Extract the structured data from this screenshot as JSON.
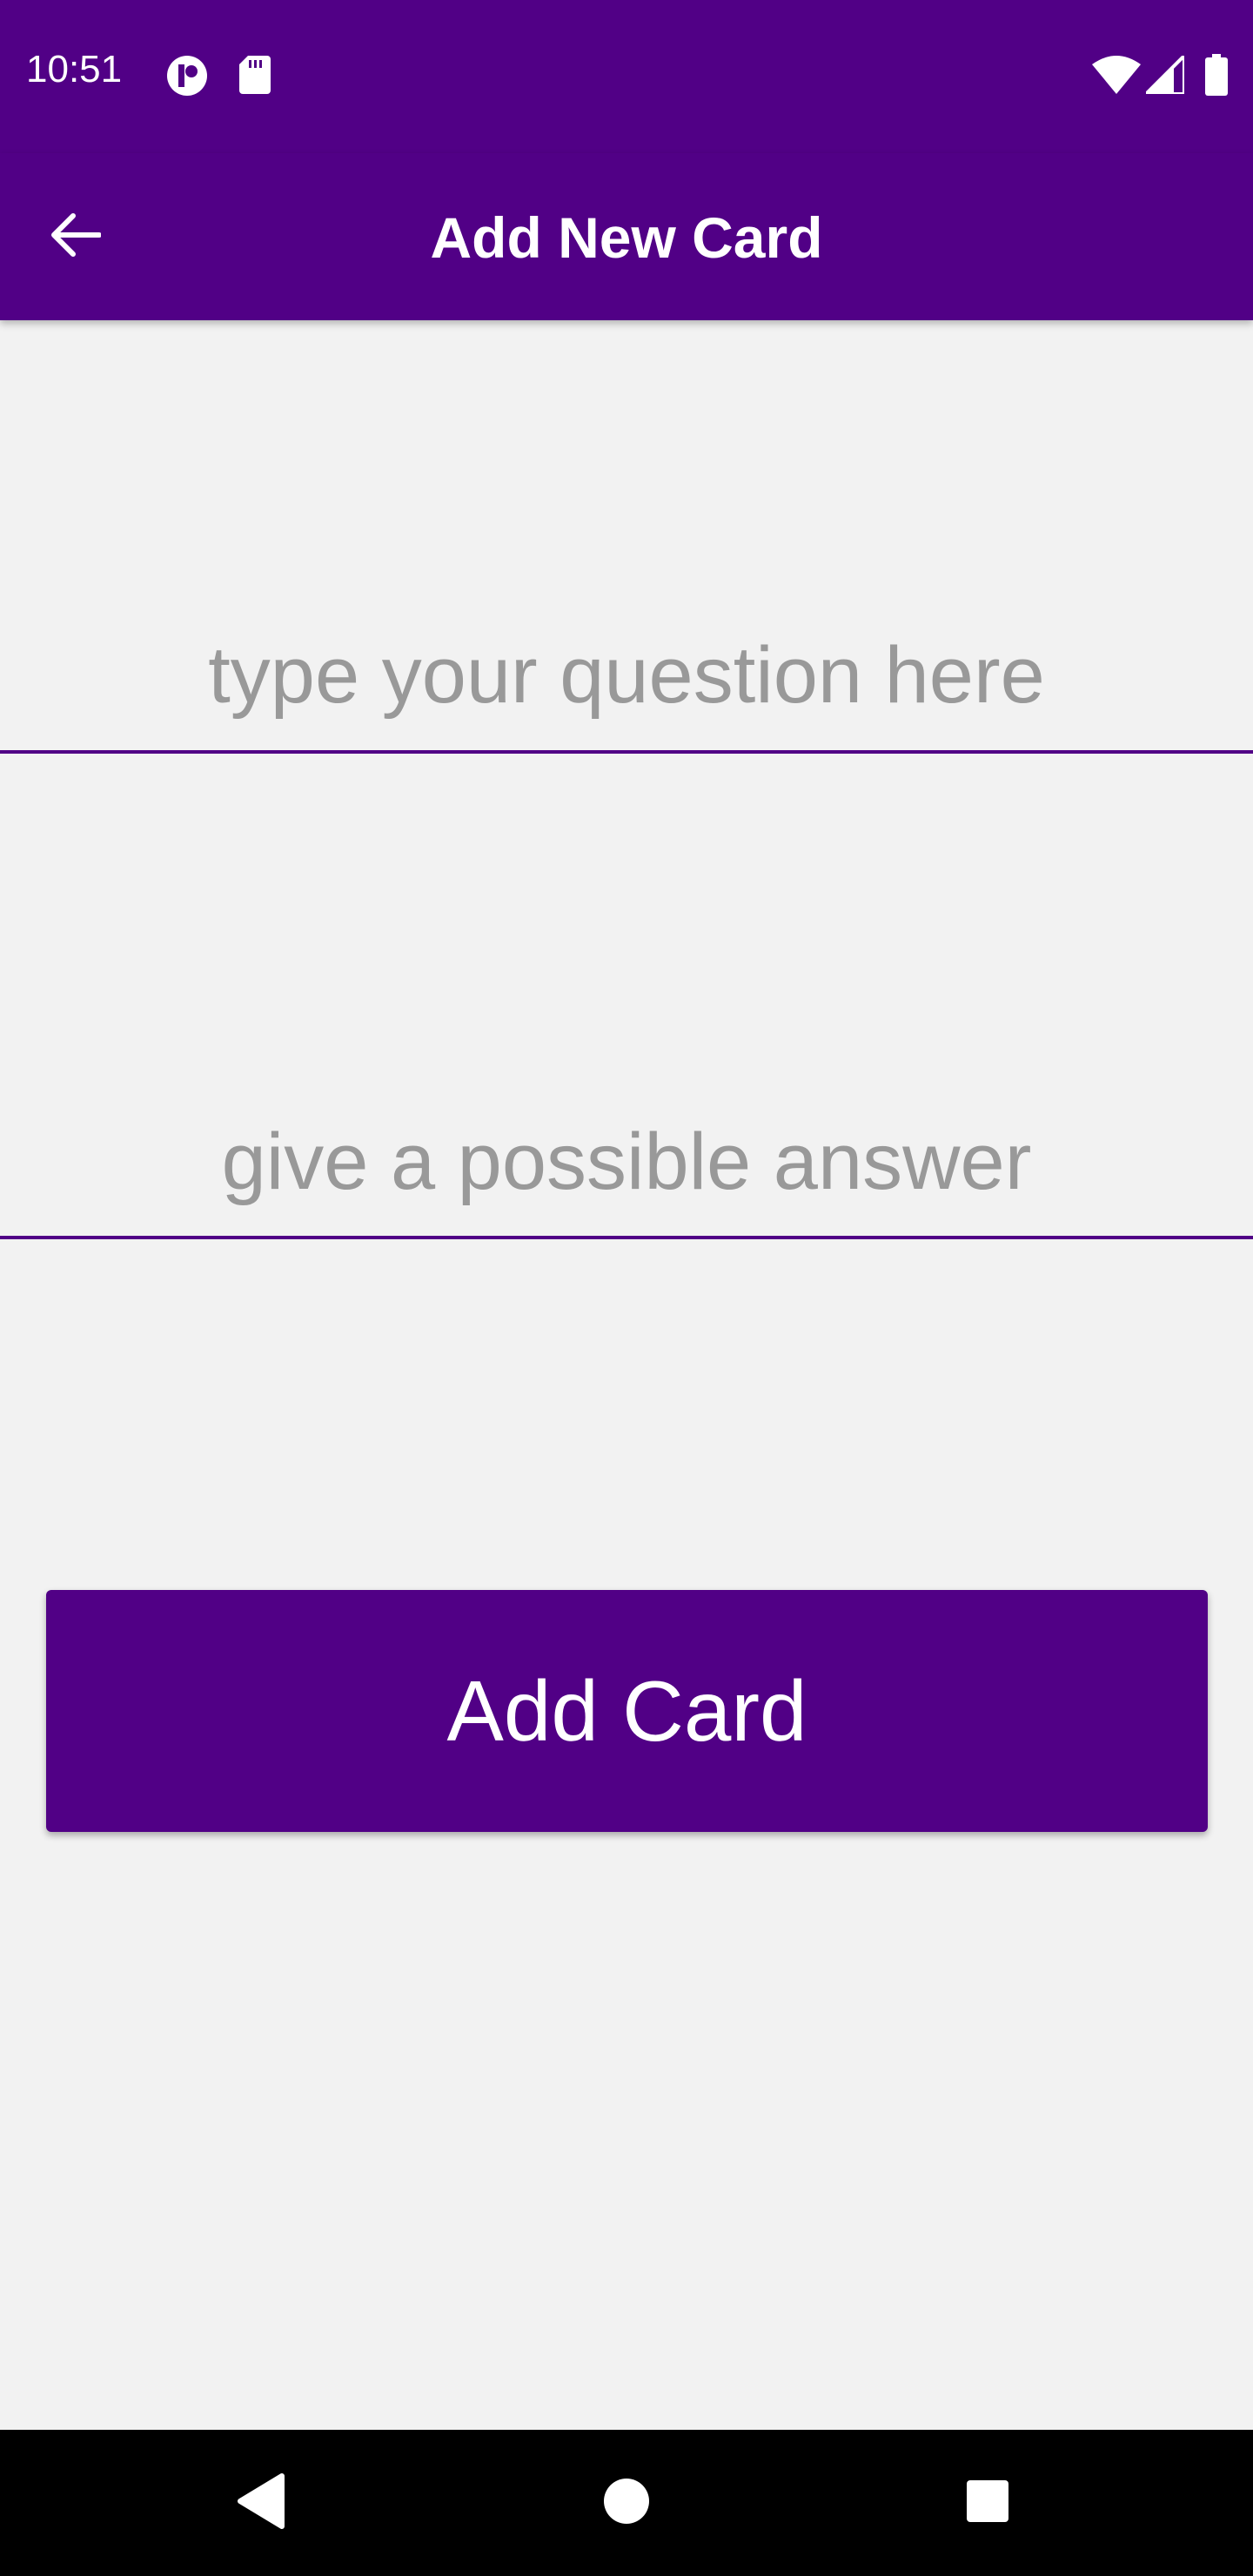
{
  "status_bar": {
    "time": "10:51",
    "left_icons": [
      "notification-app-icon",
      "sd-card-icon"
    ],
    "right_icons": [
      "wifi-icon",
      "cell-signal-icon",
      "battery-icon"
    ]
  },
  "app_bar": {
    "title": "Add New Card",
    "back_icon": "arrow-back-icon",
    "background_color": "#510086"
  },
  "form": {
    "question": {
      "value": "",
      "placeholder": "type your question here"
    },
    "answer": {
      "value": "",
      "placeholder": "give a possible answer"
    },
    "submit_label": "Add Card"
  },
  "nav_bar": {
    "buttons": [
      "back-triangle-icon",
      "home-circle-icon",
      "recents-square-icon"
    ]
  },
  "colors": {
    "primary": "#510086",
    "background": "#f2f2f2",
    "placeholder": "#999999"
  }
}
